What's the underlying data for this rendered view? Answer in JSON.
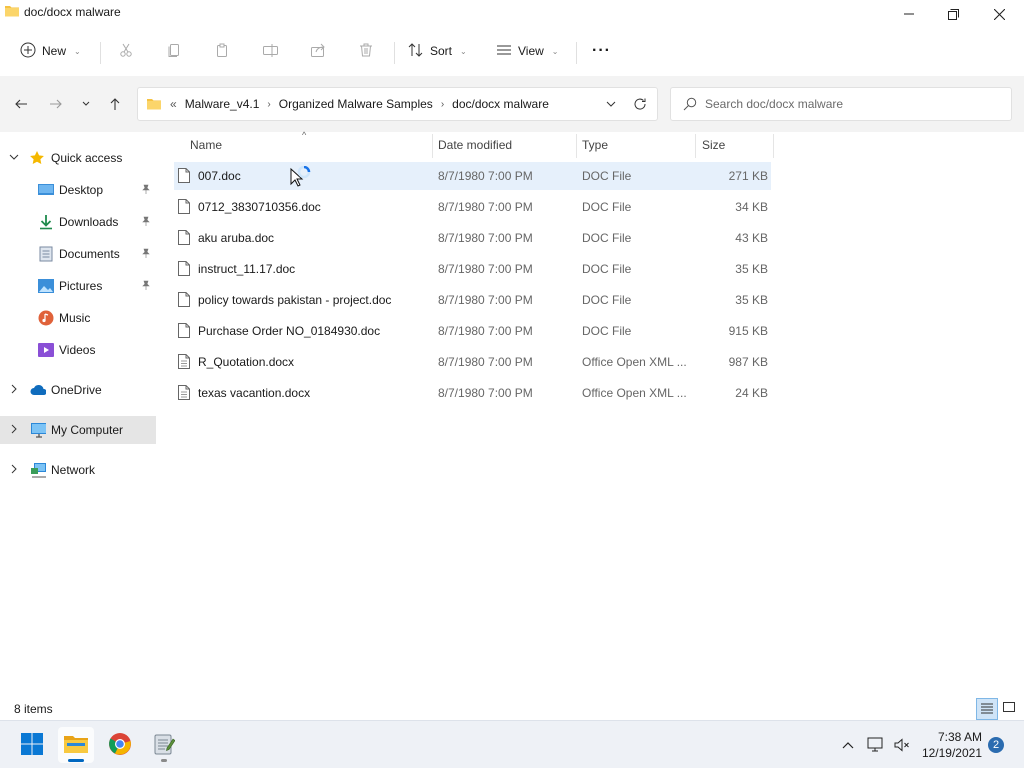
{
  "window": {
    "title": "doc/docx malware"
  },
  "toolbar": {
    "new_label": "New",
    "sort_label": "Sort",
    "view_label": "View",
    "more_label": "···"
  },
  "address": {
    "overflow": "«",
    "crumbs": [
      "Malware_v4.1",
      "Organized Malware Samples",
      "doc/docx malware"
    ]
  },
  "search": {
    "placeholder": "Search doc/docx malware"
  },
  "sidebar": {
    "quick_access": "Quick access",
    "items": [
      {
        "label": "Desktop",
        "icon": "desktop-icon",
        "pinned": true
      },
      {
        "label": "Downloads",
        "icon": "downloads-icon",
        "pinned": true
      },
      {
        "label": "Documents",
        "icon": "documents-icon",
        "pinned": true
      },
      {
        "label": "Pictures",
        "icon": "pictures-icon",
        "pinned": true
      },
      {
        "label": "Music",
        "icon": "music-icon",
        "pinned": false
      },
      {
        "label": "Videos",
        "icon": "videos-icon",
        "pinned": false
      }
    ],
    "onedrive": "OneDrive",
    "my_computer": "My Computer",
    "network": "Network"
  },
  "columns": {
    "name": "Name",
    "date": "Date modified",
    "type": "Type",
    "size": "Size"
  },
  "files": [
    {
      "name": "007.doc",
      "date": "8/7/1980 7:00 PM",
      "type": "DOC File",
      "size": "271 KB"
    },
    {
      "name": "0712_3830710356.doc",
      "date": "8/7/1980 7:00 PM",
      "type": "DOC File",
      "size": "34 KB"
    },
    {
      "name": "aku aruba.doc",
      "date": "8/7/1980 7:00 PM",
      "type": "DOC File",
      "size": "43 KB"
    },
    {
      "name": "instruct_11.17.doc",
      "date": "8/7/1980 7:00 PM",
      "type": "DOC File",
      "size": "35 KB"
    },
    {
      "name": "policy towards pakistan - project.doc",
      "date": "8/7/1980 7:00 PM",
      "type": "DOC File",
      "size": "35 KB"
    },
    {
      "name": "Purchase Order NO_0184930.doc",
      "date": "8/7/1980 7:00 PM",
      "type": "DOC File",
      "size": "915 KB"
    },
    {
      "name": "R_Quotation.docx",
      "date": "8/7/1980 7:00 PM",
      "type": "Office Open XML ...",
      "size": "987 KB"
    },
    {
      "name": "texas vacantion.docx",
      "date": "8/7/1980 7:00 PM",
      "type": "Office Open XML ...",
      "size": "24 KB"
    }
  ],
  "status": {
    "item_count": "8 items"
  },
  "taskbar": {
    "time": "7:38 AM",
    "date": "12/19/2021",
    "notifications": "2"
  },
  "colors": {
    "accent": "#0067c0",
    "selection": "#e6f0fb",
    "folder": "#f5c242"
  }
}
